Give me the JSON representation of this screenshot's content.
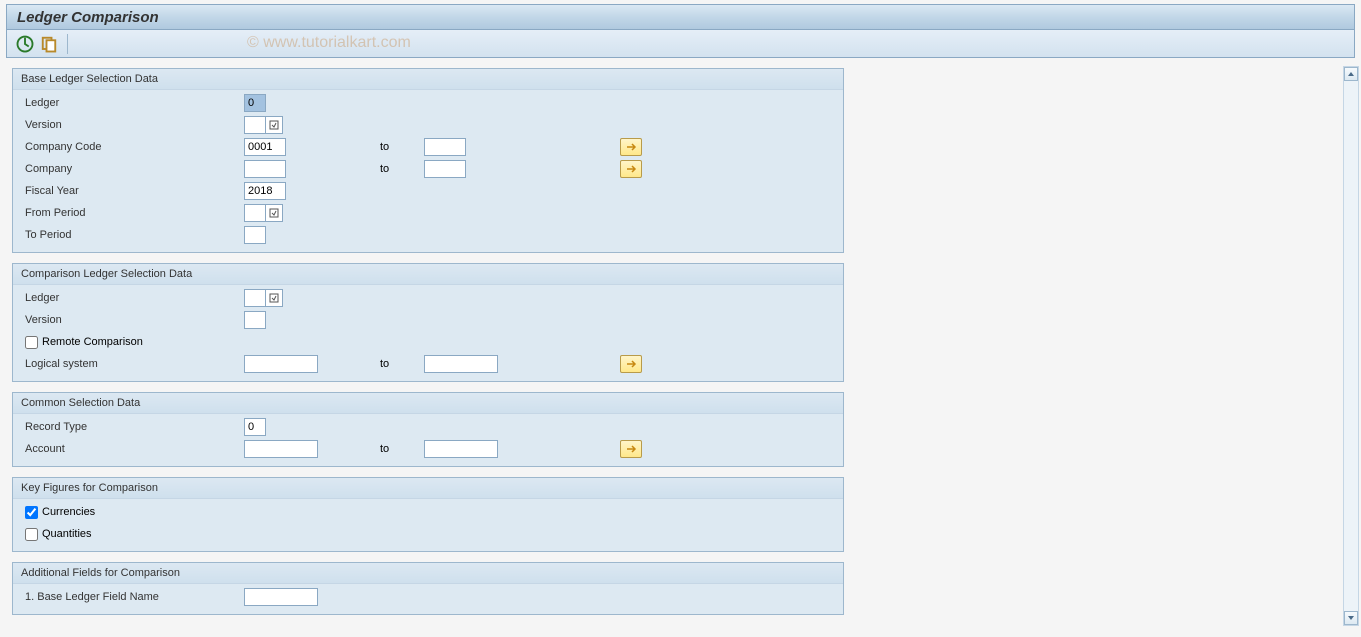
{
  "page_title": "Ledger Comparison",
  "watermark": "© www.tutorialkart.com",
  "labels": {
    "to": "to"
  },
  "groups": {
    "base": {
      "title": "Base Ledger Selection Data",
      "fields": {
        "ledger_label": "Ledger",
        "ledger_value": "0",
        "version_label": "Version",
        "version_value": "",
        "company_code_label": "Company Code",
        "company_code_from": "0001",
        "company_code_to": "",
        "company_label": "Company",
        "company_from": "",
        "company_to": "",
        "fiscal_year_label": "Fiscal Year",
        "fiscal_year_value": "2018",
        "from_period_label": "From Period",
        "from_period_value": "",
        "to_period_label": "To Period",
        "to_period_value": ""
      }
    },
    "comp": {
      "title": "Comparison Ledger Selection Data",
      "fields": {
        "ledger_label": "Ledger",
        "ledger_value": "",
        "version_label": "Version",
        "version_value": "",
        "remote_label": "Remote Comparison",
        "logical_system_label": "Logical system",
        "logical_system_from": "",
        "logical_system_to": ""
      }
    },
    "common": {
      "title": "Common Selection Data",
      "fields": {
        "record_type_label": "Record Type",
        "record_type_value": "0",
        "account_label": "Account",
        "account_from": "",
        "account_to": ""
      }
    },
    "keyfig": {
      "title": "Key Figures for Comparison",
      "fields": {
        "currencies_label": "Currencies",
        "quantities_label": "Quantities"
      }
    },
    "addl": {
      "title": "Additional Fields for Comparison",
      "fields": {
        "field1_label": "1. Base Ledger Field Name",
        "field1_value": ""
      }
    }
  }
}
